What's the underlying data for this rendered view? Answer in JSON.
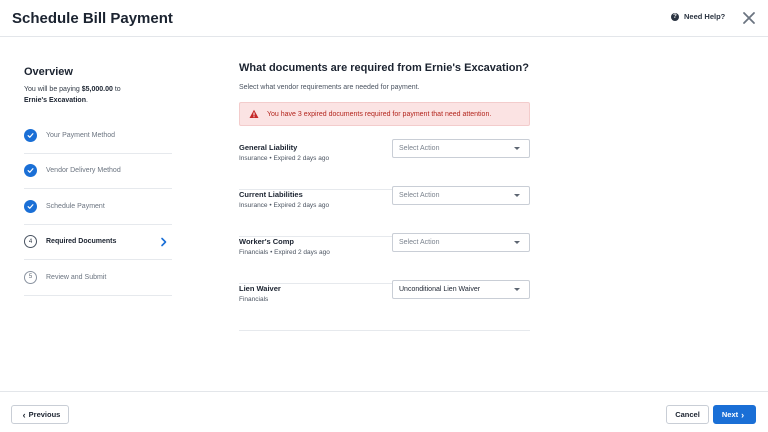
{
  "header": {
    "title": "Schedule Bill Payment",
    "help_label": "Need Help?"
  },
  "overview": {
    "title": "Overview",
    "text_prefix": "You will be paying ",
    "amount": "$5,000.00",
    "text_mid": " to",
    "vendor": "Ernie's Excavation",
    "text_end": "."
  },
  "steps": [
    {
      "label": "Your Payment Method",
      "status": "complete"
    },
    {
      "label": "Vendor Delivery Method",
      "status": "complete"
    },
    {
      "label": "Schedule Payment",
      "status": "complete"
    },
    {
      "label": "Required Documents",
      "status": "current",
      "number": "4"
    },
    {
      "label": "Review and Submit",
      "status": "upcoming",
      "number": "5"
    }
  ],
  "main": {
    "title": "What documents are required from Ernie's Excavation?",
    "subtitle": "Select what vendor requirements are needed for payment.",
    "alert": "You have 3 expired documents required for payment that need attention."
  },
  "documents": [
    {
      "name": "General Liability",
      "category": "Insurance",
      "sep": " • ",
      "status": "Expired 2 days ago",
      "select_value": "Select Action"
    },
    {
      "name": "Current Liabilities",
      "category": "Insurance",
      "sep": " • ",
      "status": "Expired 2 days ago",
      "select_value": "Select Action"
    },
    {
      "name": "Worker's Comp",
      "category": "Financials",
      "sep": " • ",
      "status": "Expired 2 days ago",
      "select_value": "Select Action"
    },
    {
      "name": "Lien Waiver",
      "category": "Financials",
      "sep": "",
      "status": "",
      "select_value": "Unconditional Lien Waiver"
    }
  ],
  "footer": {
    "previous_label": "Previous",
    "cancel_label": "Cancel",
    "next_label": "Next"
  },
  "colors": {
    "accent": "#1a6fd6",
    "alert_bg": "#fbe3e3",
    "alert_text": "#b3261e"
  },
  "icons": {
    "help": "question-circle-icon",
    "close": "close-icon",
    "step_done": "check-circle-icon",
    "warning": "warning-triangle-icon"
  }
}
